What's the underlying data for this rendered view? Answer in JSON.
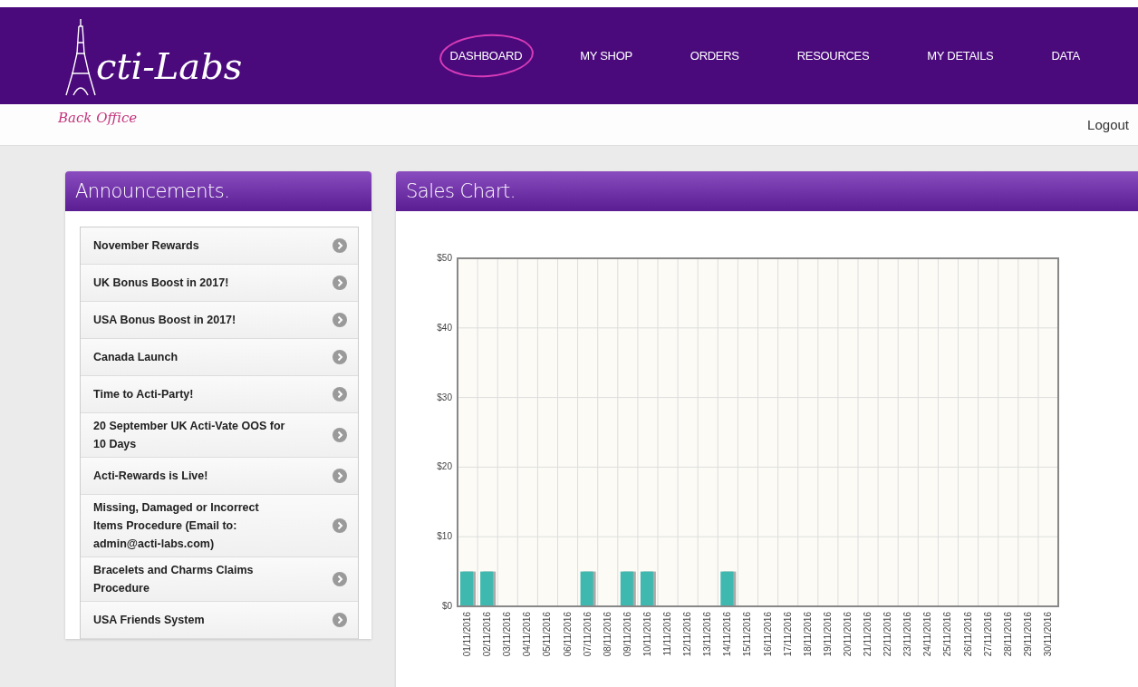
{
  "header": {
    "logo": "cti-Labs",
    "subtitle": "Back Office",
    "nav": [
      {
        "label": "DASHBOARD",
        "selected": true
      },
      {
        "label": "MY SHOP",
        "selected": false
      },
      {
        "label": "ORDERS",
        "selected": false
      },
      {
        "label": "RESOURCES",
        "selected": false
      },
      {
        "label": "MY DETAILS",
        "selected": false
      },
      {
        "label": "DATA",
        "selected": false
      }
    ],
    "logout": "Logout"
  },
  "announcements": {
    "title": "Announcements.",
    "items": [
      "November Rewards",
      "UK Bonus Boost in 2017!",
      "USA Bonus Boost in 2017!",
      "Canada Launch",
      "Time to Acti-Party!",
      "20 September UK Acti-Vate OOS for 10 Days",
      "Acti-Rewards is Live!",
      "Missing, Damaged or Incorrect Items Procedure (Email to: admin@acti-labs.com)",
      "Bracelets and Charms Claims Procedure",
      "USA Friends System"
    ]
  },
  "sales_chart": {
    "title": "Sales Chart.",
    "chart_data": {
      "type": "bar",
      "categories": [
        "01/11/2016",
        "02/11/2016",
        "03/11/2016",
        "04/11/2016",
        "05/11/2016",
        "06/11/2016",
        "07/11/2016",
        "08/11/2016",
        "09/11/2016",
        "10/11/2016",
        "11/11/2016",
        "12/11/2016",
        "13/11/2016",
        "14/11/2016",
        "15/11/2016",
        "16/11/2016",
        "17/11/2016",
        "18/11/2016",
        "19/11/2016",
        "20/11/2016",
        "21/11/2016",
        "22/11/2016",
        "23/11/2016",
        "24/11/2016",
        "25/11/2016",
        "26/11/2016",
        "27/11/2016",
        "28/11/2016",
        "29/11/2016",
        "30/11/2016"
      ],
      "grid": true,
      "series": [
        {
          "color": "#3fb8af",
          "values": [
            5,
            5,
            0,
            0,
            0,
            0,
            5,
            0,
            5,
            5,
            0,
            0,
            0,
            5,
            0,
            0,
            0,
            0,
            0,
            0,
            0,
            0,
            0,
            0,
            0,
            0,
            0,
            0,
            0,
            0
          ]
        }
      ],
      "ylim": [
        0,
        50
      ],
      "yticks": [
        {
          "value": 0,
          "label": "$0"
        },
        {
          "value": 10,
          "label": "$10"
        },
        {
          "value": 20,
          "label": "$20"
        },
        {
          "value": 30,
          "label": "$30"
        },
        {
          "value": 40,
          "label": "$40"
        },
        {
          "value": 50,
          "label": "$50"
        }
      ]
    }
  }
}
